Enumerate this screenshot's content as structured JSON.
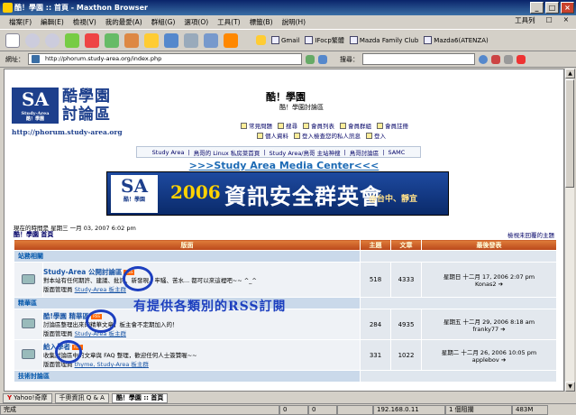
{
  "window": {
    "title": "酷！學園 :: 首頁 - Maxthon Browser",
    "buttons": [
      "_",
      "□",
      "×"
    ]
  },
  "menu": {
    "items": [
      "檔案(F)",
      "編輯(E)",
      "檢視(V)",
      "我的最愛(A)",
      "群組(G)",
      "選項(O)",
      "工具(T)",
      "標籤(B)",
      "說明(H)"
    ],
    "right_items": [
      "工具列",
      "□",
      "×"
    ]
  },
  "favorites": [
    {
      "label": "Gmail"
    },
    {
      "label": "IFocp繁體"
    },
    {
      "label": "Mazda Family Club"
    },
    {
      "label": "Mazda6(ATENZA)"
    }
  ],
  "address": {
    "label": "網址：",
    "url": "http://phorum.study-area.org/index.php",
    "search_label": "搜尋："
  },
  "site": {
    "logo_mark": "SA",
    "logo_sub": "Study-Area",
    "logo_badge": "酷！學園",
    "logo_text_line1": "酷學園",
    "logo_text_line2": "討論區",
    "logo_url": "http://phorum.study-area.org",
    "title": "酷！學園",
    "description": "酷！學園討論區",
    "nav_row1": [
      "常見問題",
      "搜尋",
      "會員列表",
      "會員群組",
      "會員註冊"
    ],
    "nav_row2": [
      "個人資料",
      "登入檢查您的私人訊息",
      "登入"
    ],
    "links": [
      "Study Area",
      "鳥哥的 Linux 私房菜首頁",
      "Study Area/鳥哥 主站神搜",
      "鳥哥討論區",
      "SAMC"
    ],
    "links_sep": "|",
    "media_center": ">>>Study Area Media Center<<<",
    "banner": {
      "logo_mark": "SA",
      "logo_sub": "酷！學園",
      "year": "2006",
      "title": "資訊安全群英會",
      "subtitle": "@台中、靜宜"
    },
    "current_time": "現在的時間是 星期三 一月 03, 2007 6:02 pm",
    "breadcrumb": "酷！學園 首頁",
    "unanswered": "檢視未回覆的主題"
  },
  "table": {
    "headers": [
      "版面",
      "主題",
      "文章",
      "最後發表"
    ],
    "rss_label": "RSS",
    "categories": [
      {
        "name": "站務相關",
        "forums": [
          {
            "name": "Study-Area 公開討論區",
            "desc": "對本站有任何期許、建議、批評、新發現、牢騷、苦水... 都可以來這裡吧~~ ^_^",
            "mods_prefix": "版面管理員",
            "mods": "Study-Area 板主群",
            "topics": "518",
            "posts": "4333",
            "last_date": "星期日 十二月 17, 2006 2:07 pm",
            "last_user": "Konas2"
          }
        ]
      },
      {
        "name": "精華區",
        "forums": [
          {
            "name": "酷!學園 精華區",
            "desc": "討論區整理出來的精華文章，板主會不定期加入的！",
            "mods_prefix": "版面管理員",
            "mods": "Study-Area 板主群",
            "topics": "284",
            "posts": "4935",
            "last_date": "星期五 十二月 29, 2006 8:18 am",
            "last_user": "franky77"
          },
          {
            "name": "給入學者",
            "desc": "收集討論區中的文章與 FAQ 整理，歡迎任何人士簽贊喔~~",
            "mods_prefix": "版面管理員",
            "mods": "thyme, Study-Area 板主群",
            "topics": "331",
            "posts": "1022",
            "last_date": "星期二 十二月 26, 2006 10:05 pm",
            "last_user": "applebov"
          }
        ]
      },
      {
        "name": "技術討論區",
        "forums": []
      }
    ]
  },
  "annotation": "有提供各類別的RSS訂閱",
  "tabs": [
    "Yahoo!奇摩",
    "千奧資訊 Q & A",
    "酷！學園 :: 首頁"
  ],
  "status": {
    "text": "完成",
    "count1": "0",
    "count2": "0",
    "ip": "192.168.0.11",
    "popup": "1 個阻攔",
    "memory": "483M"
  },
  "colors": {
    "title_bar": "#0a246a",
    "table_header": "#c8561f",
    "category_bg": "#cad9ea",
    "annotation": "#1c3fbf",
    "rss_badge": "#ff6600"
  }
}
